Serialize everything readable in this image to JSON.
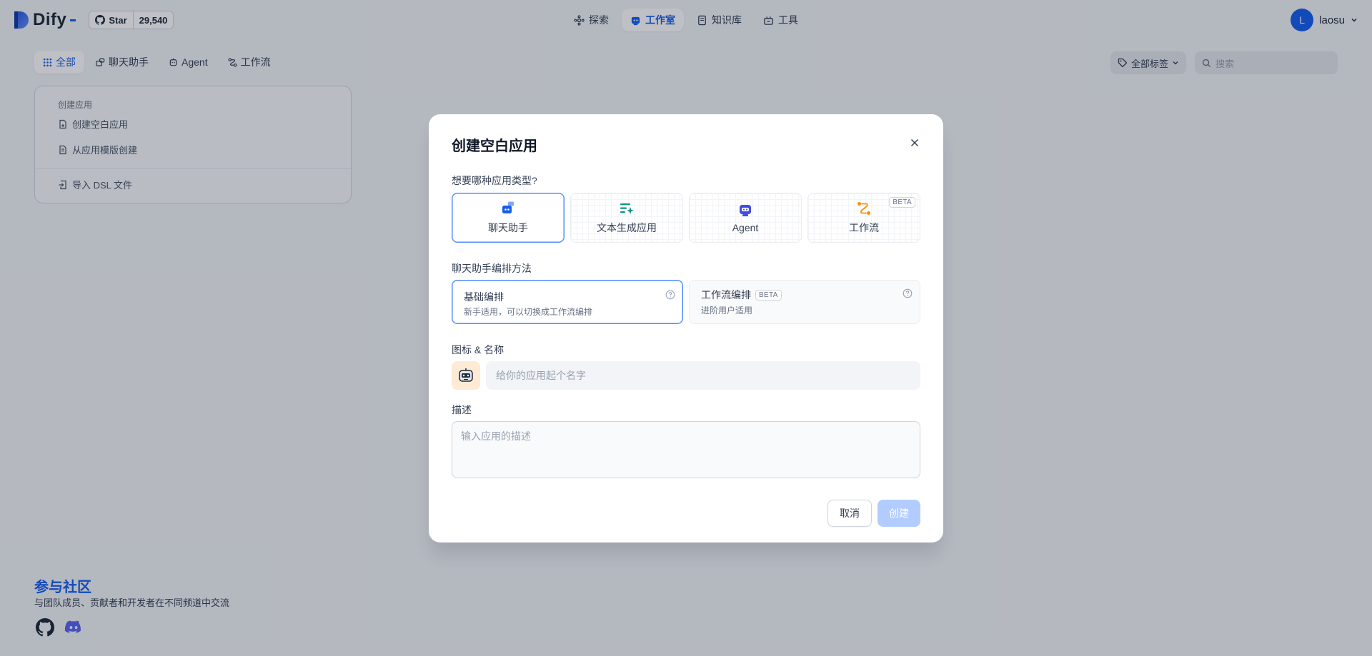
{
  "header": {
    "logo_text": "Dify",
    "github": {
      "star_label": "Star",
      "star_count": "29,540"
    },
    "nav": [
      {
        "label": "探索",
        "icon": "compass-icon"
      },
      {
        "label": "工作室",
        "icon": "robot-icon",
        "active": true
      },
      {
        "label": "知识库",
        "icon": "book-icon"
      },
      {
        "label": "工具",
        "icon": "toolbox-icon"
      }
    ],
    "user": {
      "initial": "L",
      "name": "laosu"
    }
  },
  "toolbar": {
    "tabs": [
      {
        "label": "全部",
        "active": true
      },
      {
        "label": "聊天助手"
      },
      {
        "label": "Agent"
      },
      {
        "label": "工作流"
      }
    ],
    "tag_filter": "全部标签",
    "search_placeholder": "搜索"
  },
  "create_card": {
    "title": "创建应用",
    "items": [
      "创建空白应用",
      "从应用模版创建",
      "导入 DSL 文件"
    ]
  },
  "community": {
    "title": "参与社区",
    "description": "与团队成员、贡献者和开发者在不同频道中交流"
  },
  "modal": {
    "title": "创建空白应用",
    "type_label": "想要哪种应用类型?",
    "types": [
      {
        "label": "聊天助手",
        "selected": true,
        "icon": "chat-assistant-icon",
        "color": "#155eef"
      },
      {
        "label": "文本生成应用",
        "icon": "text-generator-icon",
        "color": "#0e9384"
      },
      {
        "label": "Agent",
        "icon": "agent-icon",
        "color": "#444ce7"
      },
      {
        "label": "工作流",
        "icon": "workflow-icon",
        "color": "#f79009",
        "badge": "BETA"
      }
    ],
    "mode_label": "聊天助手编排方法",
    "modes": [
      {
        "title": "基础编排",
        "desc": "新手适用，可以切换成工作流编排",
        "selected": true
      },
      {
        "title": "工作流编排",
        "desc": "进阶用户适用",
        "badge": "BETA"
      }
    ],
    "icon_name_label": "图标 & 名称",
    "name_placeholder": "给你的应用起个名字",
    "desc_label": "描述",
    "desc_placeholder": "输入应用的描述",
    "cancel_label": "取消",
    "create_label": "创建"
  },
  "colors": {
    "primary": "#155eef",
    "primary_disabled": "#b2ccff",
    "app_icon_bg": "#ffead5"
  }
}
